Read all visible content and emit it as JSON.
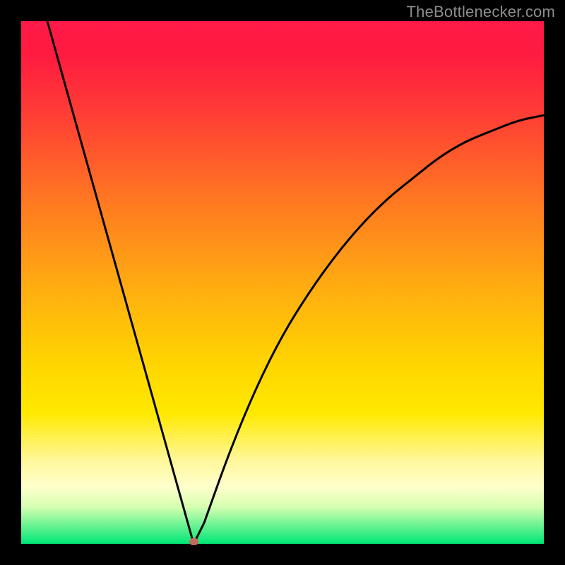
{
  "watermark": "TheBottlenecker.com",
  "colors": {
    "curve_stroke": "#000000",
    "frame_bg": "#000000",
    "marker_fill": "#c26a5e"
  },
  "chart_data": {
    "type": "line",
    "title": "",
    "xlabel": "",
    "ylabel": "",
    "xlim": [
      0,
      100
    ],
    "ylim": [
      0,
      100
    ],
    "annotations": [],
    "series": [
      {
        "name": "bottleneck-curve",
        "description": "V-shaped bottleneck percentage curve; minimum near x≈33.",
        "x": [
          5,
          10,
          15,
          20,
          25,
          30,
          33,
          35,
          40,
          45,
          50,
          55,
          60,
          65,
          70,
          75,
          80,
          85,
          90,
          95,
          100
        ],
        "y": [
          100,
          83,
          66,
          48,
          31,
          12,
          0,
          4,
          18,
          30,
          40,
          48,
          55,
          61,
          66,
          70,
          74,
          77,
          79,
          81,
          82
        ]
      }
    ],
    "marker": {
      "x": 33,
      "y": 0
    }
  }
}
